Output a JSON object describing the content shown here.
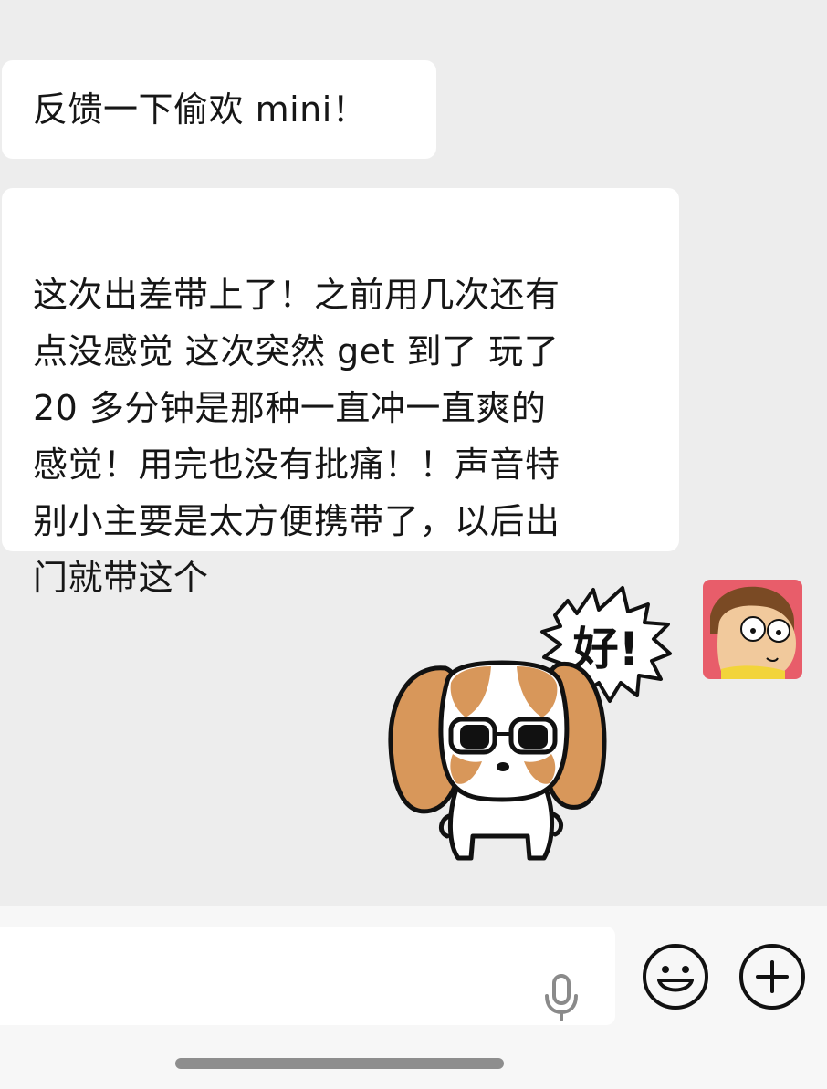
{
  "messages": [
    {
      "text": "反馈一下偷欢 mini！"
    },
    {
      "text": "这次出差带上了！之前用几次还有\n点没感觉 这次突然 get 到了 玩了\n20 多分钟是那种一直冲一直爽的\n感觉！用完也没有批痛！！声音特\n别小主要是太方便携带了，以后出\n门就带这个"
    }
  ],
  "sticker": {
    "text": "好!",
    "icon": "dog-sticker"
  },
  "avatar": {
    "icon": "cartoon-boy-avatar"
  },
  "input_bar": {
    "mic_icon": "microphone-icon",
    "emoji_icon": "smiley-icon",
    "plus_icon": "plus-icon"
  },
  "colors": {
    "background": "#ededed",
    "bubble": "#ffffff",
    "avatar_bg": "#e85d6a",
    "dog_ears": "#d8975a"
  }
}
